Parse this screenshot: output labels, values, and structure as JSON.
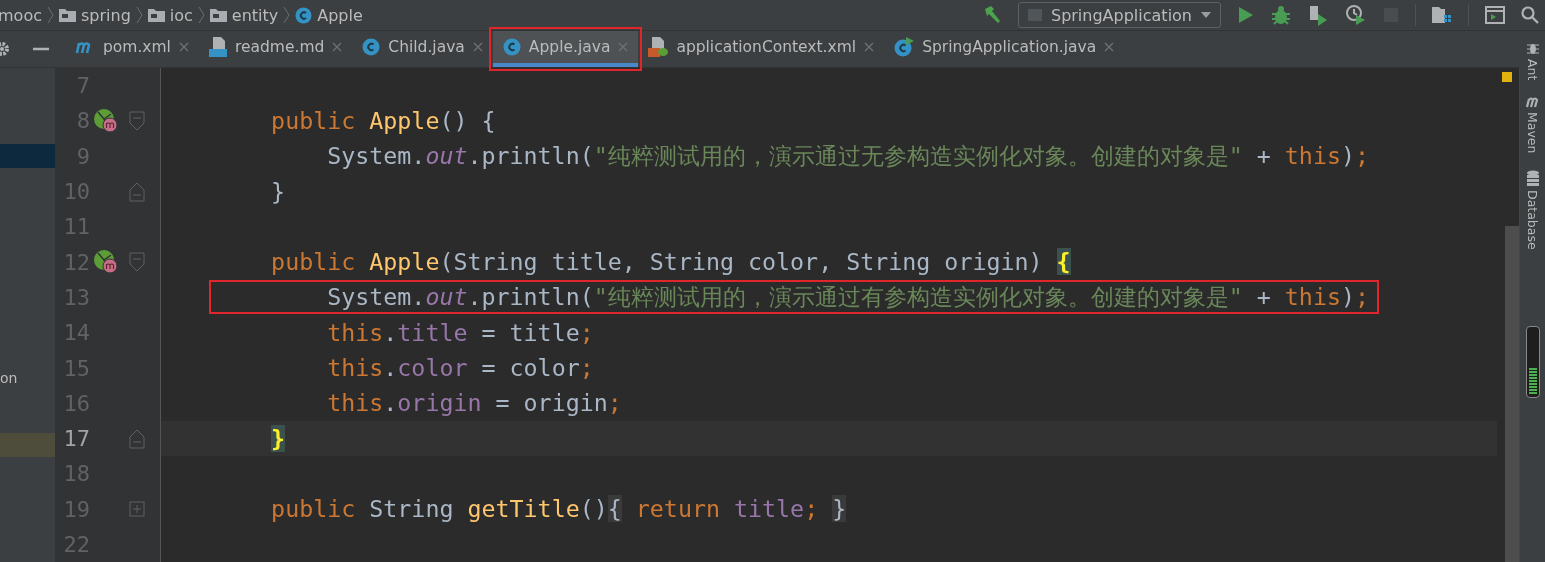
{
  "breadcrumbs": [
    {
      "label": "mooc",
      "kind": "module"
    },
    {
      "label": "spring",
      "kind": "folder"
    },
    {
      "label": "ioc",
      "kind": "folder"
    },
    {
      "label": "entity",
      "kind": "folder"
    },
    {
      "label": "Apple",
      "kind": "class"
    }
  ],
  "run_config": {
    "label": "SpringApplication"
  },
  "tabs": [
    {
      "label": "pom.xml",
      "kind": "maven",
      "selected": false,
      "annotated": false
    },
    {
      "label": "readme.md",
      "kind": "markdown",
      "selected": false,
      "annotated": false
    },
    {
      "label": "Child.java",
      "kind": "class",
      "selected": false,
      "annotated": false
    },
    {
      "label": "Apple.java",
      "kind": "class",
      "selected": true,
      "annotated": true
    },
    {
      "label": "applicationContext.xml",
      "kind": "spring-xml",
      "selected": false,
      "annotated": false
    },
    {
      "label": "SpringApplication.java",
      "kind": "runnable-class",
      "selected": false,
      "annotated": false
    }
  ],
  "project_panel": {
    "text": "on"
  },
  "lines": [
    {
      "number": "7",
      "kind": "plain",
      "current": false,
      "annotated": false,
      "marker": false
    },
    {
      "number": "8",
      "kind": "fold-start",
      "tokens": [
        {
          "kind": "kw",
          "text": "    public "
        },
        {
          "kind": "method",
          "text": "Apple"
        },
        {
          "kind": "plain",
          "text": "() {"
        }
      ],
      "current": false,
      "annotated": false,
      "marker": true
    },
    {
      "number": "9",
      "kind": "plain",
      "tokens": [
        {
          "kind": "plain",
          "text": "        System."
        },
        {
          "kind": "static",
          "text": "out"
        },
        {
          "kind": "plain",
          "text": ".println("
        },
        {
          "kind": "str",
          "text": "\"纯粹测试用的，演示通过无参构造实例化对象。创建的对象是\""
        },
        {
          "kind": "plain",
          "text": " + "
        },
        {
          "kind": "kw",
          "text": "this"
        },
        {
          "kind": "plain",
          "text": ")"
        },
        {
          "kind": "kw",
          "text": ";"
        }
      ],
      "current": false,
      "annotated": false,
      "marker": false
    },
    {
      "number": "10",
      "kind": "fold-end",
      "tokens": [
        {
          "kind": "plain",
          "text": "    }"
        }
      ],
      "current": false,
      "annotated": false,
      "marker": false
    },
    {
      "number": "11",
      "kind": "plain",
      "current": false,
      "annotated": false,
      "marker": false
    },
    {
      "number": "12",
      "kind": "fold-start",
      "tokens": [
        {
          "kind": "kw",
          "text": "    public "
        },
        {
          "kind": "method",
          "text": "Apple"
        },
        {
          "kind": "plain",
          "text": "(String title, String color, String origin) "
        },
        {
          "kind": "brace",
          "text": "{"
        }
      ],
      "current": false,
      "annotated": false,
      "marker": true
    },
    {
      "number": "13",
      "kind": "plain",
      "tokens": [
        {
          "kind": "plain",
          "text": "        System."
        },
        {
          "kind": "static",
          "text": "out"
        },
        {
          "kind": "plain",
          "text": ".println("
        },
        {
          "kind": "str",
          "text": "\"纯粹测试用的，演示通过有参构造实例化对象。创建的对象是\""
        },
        {
          "kind": "plain",
          "text": " + "
        },
        {
          "kind": "kw",
          "text": "this"
        },
        {
          "kind": "plain",
          "text": ")"
        },
        {
          "kind": "kw",
          "text": ";"
        }
      ],
      "current": false,
      "annotated": true,
      "marker": false
    },
    {
      "number": "14",
      "kind": "plain",
      "tokens": [
        {
          "kind": "kw",
          "text": "        this"
        },
        {
          "kind": "plain",
          "text": "."
        },
        {
          "kind": "field",
          "text": "title"
        },
        {
          "kind": "plain",
          "text": " = title"
        },
        {
          "kind": "kw",
          "text": ";"
        }
      ],
      "current": false,
      "annotated": false,
      "marker": false
    },
    {
      "number": "15",
      "kind": "plain",
      "tokens": [
        {
          "kind": "kw",
          "text": "        this"
        },
        {
          "kind": "plain",
          "text": "."
        },
        {
          "kind": "field",
          "text": "color"
        },
        {
          "kind": "plain",
          "text": " = color"
        },
        {
          "kind": "kw",
          "text": ";"
        }
      ],
      "current": false,
      "annotated": false,
      "marker": false
    },
    {
      "number": "16",
      "kind": "plain",
      "tokens": [
        {
          "kind": "kw",
          "text": "        this"
        },
        {
          "kind": "plain",
          "text": "."
        },
        {
          "kind": "field",
          "text": "origin"
        },
        {
          "kind": "plain",
          "text": " = origin"
        },
        {
          "kind": "kw",
          "text": ";"
        }
      ],
      "current": false,
      "annotated": false,
      "marker": false
    },
    {
      "number": "17",
      "kind": "fold-end",
      "tokens": [
        {
          "kind": "brace",
          "text": "    }"
        }
      ],
      "current": true,
      "annotated": false,
      "marker": false
    },
    {
      "number": "18",
      "kind": "plain",
      "current": false,
      "annotated": false,
      "marker": false
    },
    {
      "number": "19",
      "kind": "fold-collapsed",
      "tokens": [
        {
          "kind": "kw",
          "text": "    public "
        },
        {
          "kind": "plain",
          "text": "String "
        },
        {
          "kind": "method",
          "text": "getTitle"
        },
        {
          "kind": "plain",
          "text": "()"
        },
        {
          "kind": "folded",
          "text": "{"
        },
        {
          "kind": "kw",
          "text": " return "
        },
        {
          "kind": "field",
          "text": "title"
        },
        {
          "kind": "kw",
          "text": "; "
        },
        {
          "kind": "folded",
          "text": "}"
        }
      ],
      "current": false,
      "annotated": false,
      "marker": false
    },
    {
      "number": "22",
      "kind": "plain",
      "current": false,
      "annotated": false,
      "marker": false
    }
  ],
  "side_tools": [
    {
      "label": "Ant",
      "kind": "ant"
    },
    {
      "label": "Maven",
      "kind": "maven"
    },
    {
      "label": "Database",
      "kind": "database"
    }
  ]
}
